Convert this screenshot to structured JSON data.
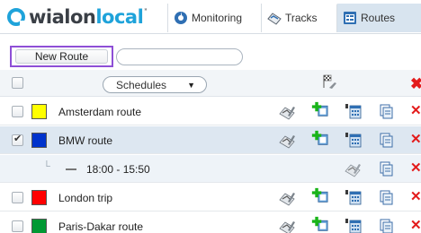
{
  "header": {
    "logo_text_1": "wialon",
    "logo_text_2": "local",
    "tabs": [
      {
        "label": "Monitoring",
        "icon": "monitoring-icon"
      },
      {
        "label": "Tracks",
        "icon": "tracks-icon"
      },
      {
        "label": "Routes",
        "icon": "routes-icon",
        "active": true
      }
    ]
  },
  "toolbar": {
    "new_route_label": "New Route",
    "search_placeholder": ""
  },
  "list_header": {
    "filter_selected": "Schedules",
    "columns_icon": "flag-wrench-icon",
    "delete_icon": "delete-all-icon"
  },
  "routes": [
    {
      "name": "Amsterdam route",
      "color": "#ffff00",
      "checked": false
    },
    {
      "name": "BMW route",
      "color": "#0033cc",
      "checked": true
    },
    {
      "name": "London trip",
      "color": "#ff0000",
      "checked": false
    },
    {
      "name": "Paris-Dakar route",
      "color": "#009933",
      "checked": false
    }
  ],
  "schedule": {
    "time": "18:00 - 15:50"
  },
  "colors": {
    "accent": "#1fa3da",
    "active_tab": "#d8e4ef",
    "selected_row": "#dde7f1",
    "highlight_border": "#8e4fd6",
    "delete": "#e31b1b"
  }
}
